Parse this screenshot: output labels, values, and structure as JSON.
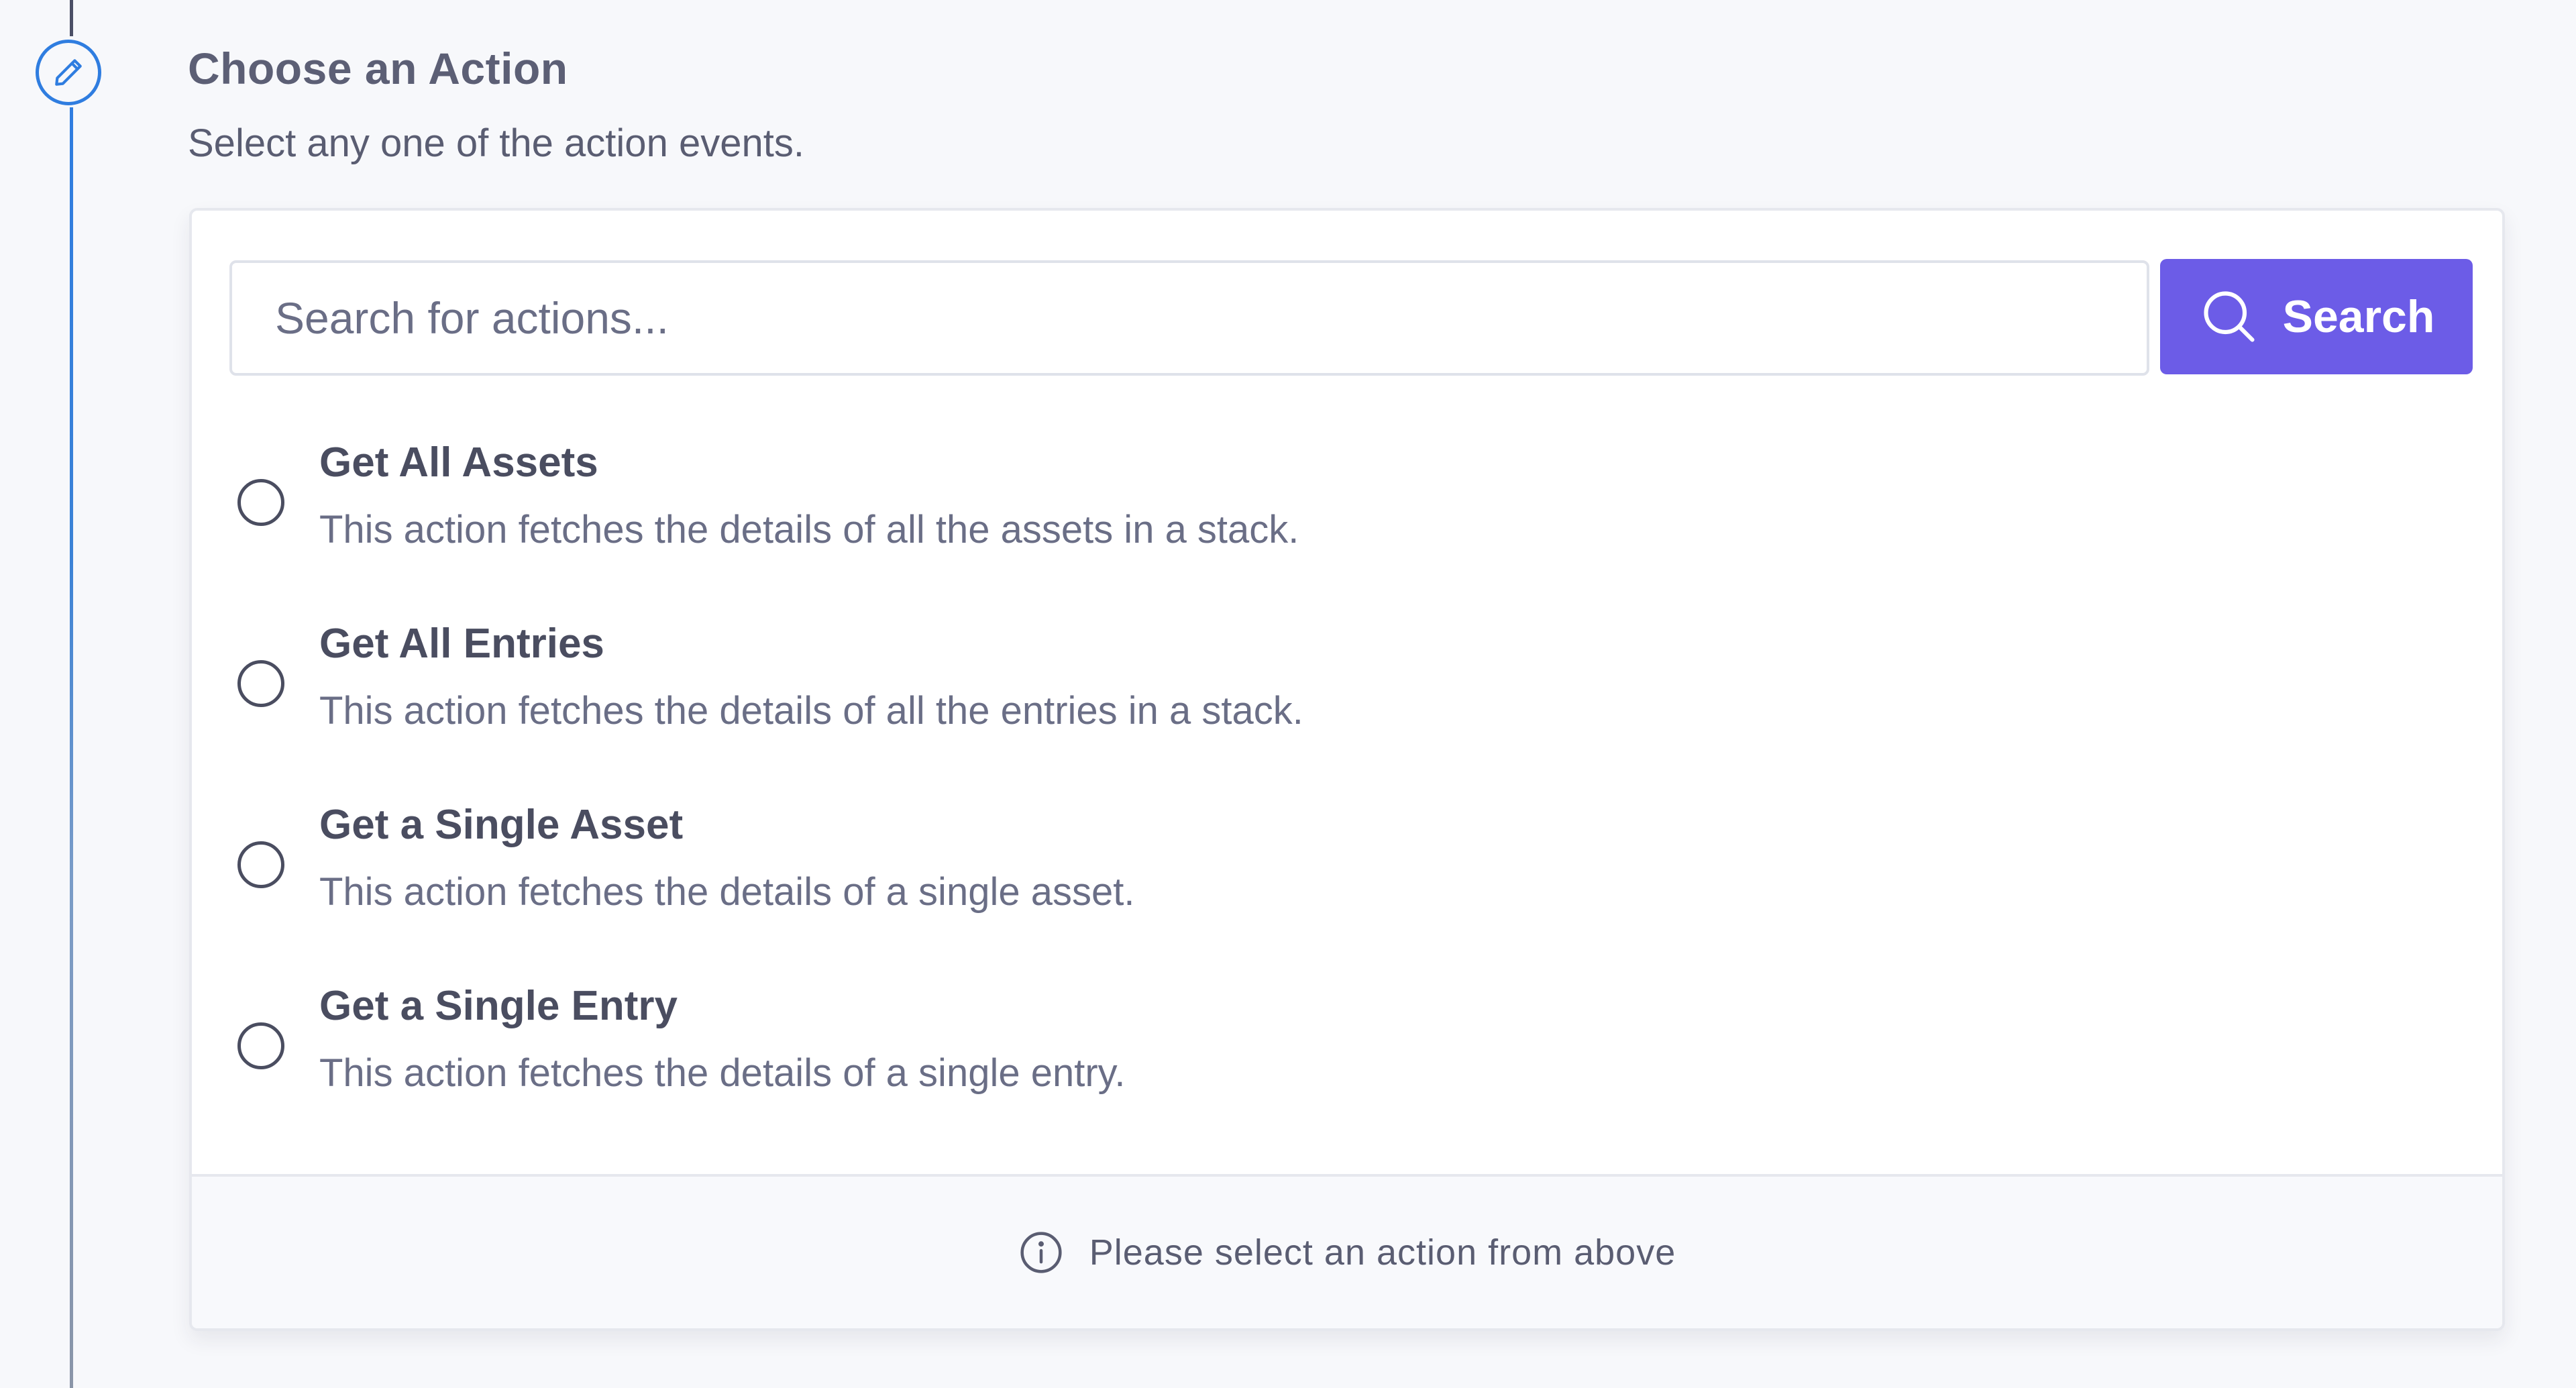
{
  "step": {
    "icon": "pencil-icon",
    "title": "Choose an Action",
    "subtitle": "Select any one of the action events."
  },
  "search": {
    "value": "",
    "placeholder": "Search for actions...",
    "button_label": "Search",
    "button_icon": "search-icon"
  },
  "actions": [
    {
      "title": "Get All Assets",
      "description": "This action fetches the details of all the assets in a stack.",
      "selected": false
    },
    {
      "title": "Get All Entries",
      "description": "This action fetches the details of all the entries in a stack.",
      "selected": false
    },
    {
      "title": "Get a Single Asset",
      "description": "This action fetches the details of a single asset.",
      "selected": false
    },
    {
      "title": "Get a Single Entry",
      "description": "This action fetches the details of a single entry.",
      "selected": false
    }
  ],
  "footer": {
    "icon": "info-icon",
    "message": "Please select an action from above"
  },
  "colors": {
    "accent": "#6c5ce7",
    "timeline": "#2f7de0",
    "text_primary": "#4a4d60",
    "text_secondary": "#6a6e86",
    "background": "#f7f8fb"
  }
}
